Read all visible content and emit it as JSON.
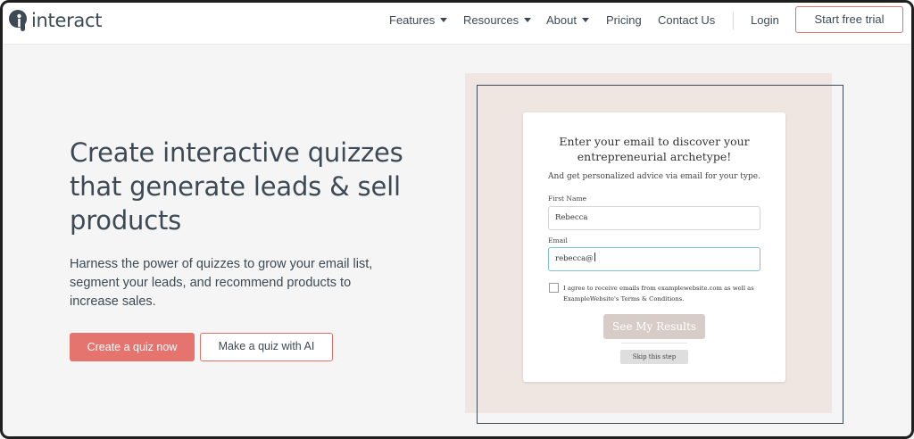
{
  "header": {
    "logo_text": "interact",
    "nav": {
      "features": "Features",
      "resources": "Resources",
      "about": "About",
      "pricing": "Pricing",
      "contact": "Contact Us",
      "login": "Login",
      "trial": "Start free trial"
    }
  },
  "hero": {
    "title": "Create interactive quizzes that generate leads & sell products",
    "subtitle": "Harness the power of quizzes to grow your email list, segment your leads, and recommend products to increase sales.",
    "primary_button": "Create a quiz now",
    "secondary_button": "Make a quiz with AI"
  },
  "quiz_card": {
    "title": "Enter your email to discover your entrepreneurial archetype!",
    "subtitle": "And get personalized advice via email for your type.",
    "first_name_label": "First Name",
    "first_name_value": "Rebecca",
    "email_label": "Email",
    "email_value": "rebecca@",
    "consent_text": "I agree to receive emails from examplewebsite.com as well as ExampleWebsite's Terms & Conditions.",
    "results_button": "See My Results",
    "skip_button": "Skip this step"
  },
  "colors": {
    "text": "#3d4a55",
    "accent": "#e5736e",
    "panel": "#efe6e2",
    "page_bg": "#f4f5f4"
  }
}
